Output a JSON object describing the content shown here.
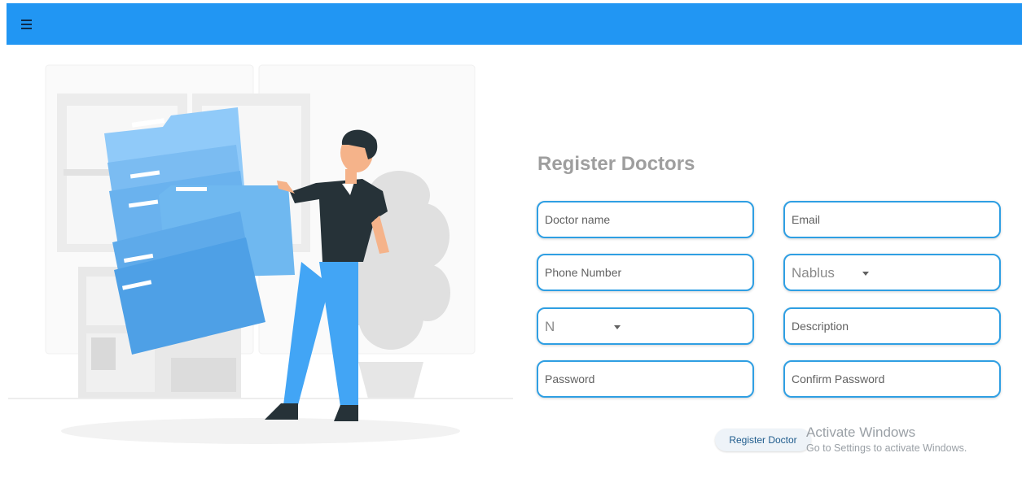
{
  "appbar": {
    "menu_icon": "hamburger-menu-icon",
    "color": "#2196f3"
  },
  "illustration": {
    "description_icon": "person-carrying-folders-illustration"
  },
  "form": {
    "title": "Register Doctors",
    "doctor_name": {
      "placeholder": "Doctor name"
    },
    "email": {
      "placeholder": "Email"
    },
    "phone": {
      "placeholder": "Phone Number"
    },
    "city_select": {
      "value": "Nablus"
    },
    "second_select": {
      "value": "N"
    },
    "description": {
      "placeholder": "Description"
    },
    "password": {
      "placeholder": "Password"
    },
    "confirm_password": {
      "placeholder": "Confirm Password"
    },
    "submit_label": "Register Doctor",
    "border_color": "#2f9fe3"
  },
  "watermark": {
    "title": "Activate Windows",
    "subtitle": "Go to Settings to activate Windows."
  }
}
